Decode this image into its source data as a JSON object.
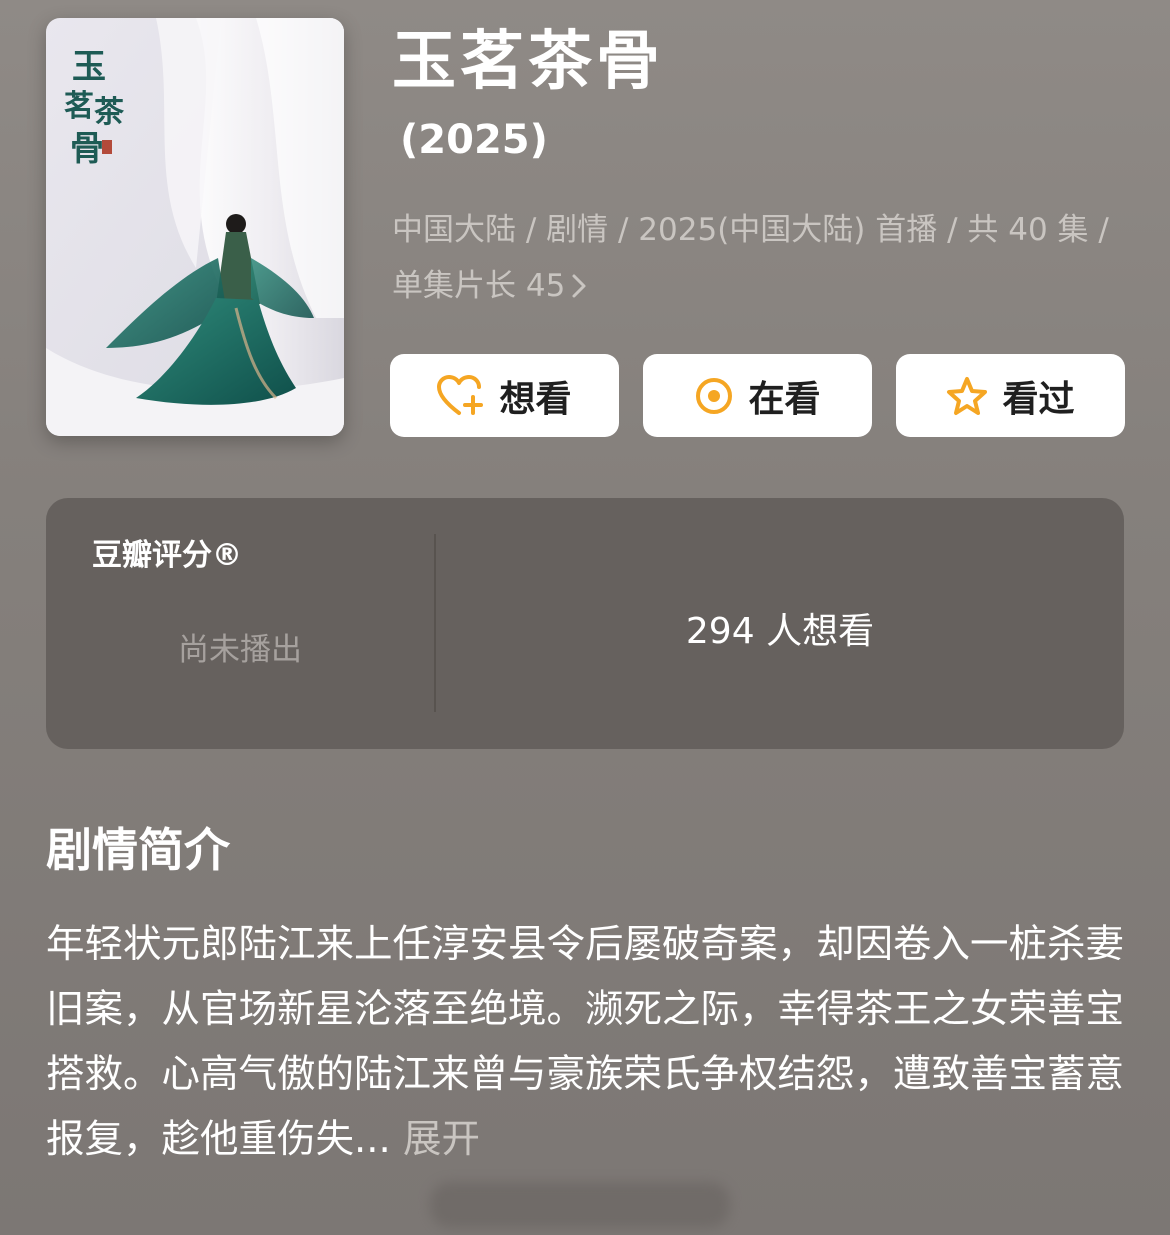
{
  "poster": {
    "calligraphy_title": "玉茗茶骨"
  },
  "header": {
    "title": "玉茗茶骨",
    "year": "(2025)",
    "meta_line1": "中国大陆 / 剧情 / 2025(中国大陆) 首播 / 共 40 集 /",
    "meta_line2": "单集片长 45"
  },
  "actions": {
    "want": "想看",
    "watching": "在看",
    "watched": "看过"
  },
  "rating": {
    "brand": "豆瓣评分®",
    "status": "尚未播出",
    "want_count": "294 人想看"
  },
  "synopsis": {
    "section_title": "剧情简介",
    "text": "年轻状元郎陆江来上任淳安县令后屡破奇案，却因卷入一桩杀妻旧案，从官场新星沦落至绝境。濒死之际，幸得茶王之女荣善宝搭救。心高气傲的陆江来曾与豪族荣氏争权结怨，遭致善宝蓄意报复，趁他重伤失...",
    "expand_label": "展开"
  },
  "colors": {
    "accent": "#f5a623",
    "card_bg": "#66615e",
    "meta_text": "#c9c5c1"
  },
  "icons": {
    "want": "heart-plus-icon",
    "watching": "target-circle-icon",
    "watched": "star-icon",
    "meta_more": "chevron-right-icon"
  }
}
